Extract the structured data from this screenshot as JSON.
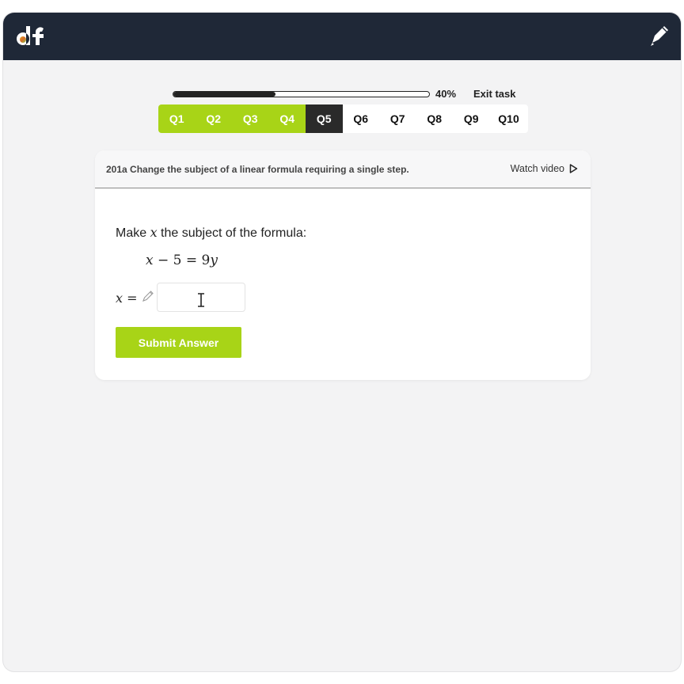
{
  "colors": {
    "topbar": "#1f2837",
    "accent": "#a8d417",
    "current_tab": "#2a2a2a"
  },
  "header": {
    "logo_text": "df",
    "pen_icon": "pen-icon"
  },
  "progress": {
    "value": 0.4,
    "label": "40%",
    "exit_label": "Exit task"
  },
  "questions": [
    {
      "label": "Q1",
      "state": "done"
    },
    {
      "label": "Q2",
      "state": "done"
    },
    {
      "label": "Q3",
      "state": "done"
    },
    {
      "label": "Q4",
      "state": "done"
    },
    {
      "label": "Q5",
      "state": "current"
    },
    {
      "label": "Q6",
      "state": "todo"
    },
    {
      "label": "Q7",
      "state": "todo"
    },
    {
      "label": "Q8",
      "state": "todo"
    },
    {
      "label": "Q9",
      "state": "todo"
    },
    {
      "label": "Q10",
      "state": "todo"
    }
  ],
  "card": {
    "objective": "201a Change the subject of a linear formula requiring a single step.",
    "watch_label": "Watch video",
    "question_prefix": "Make ",
    "question_var": "x",
    "question_suffix": " the subject of the formula:",
    "formula": {
      "lhs_var": "x",
      "middle": " − 5 = 9",
      "rhs_var": "y"
    },
    "answer_var": "x",
    "answer_eq": " =",
    "answer_value": "",
    "submit_label": "Submit Answer"
  }
}
